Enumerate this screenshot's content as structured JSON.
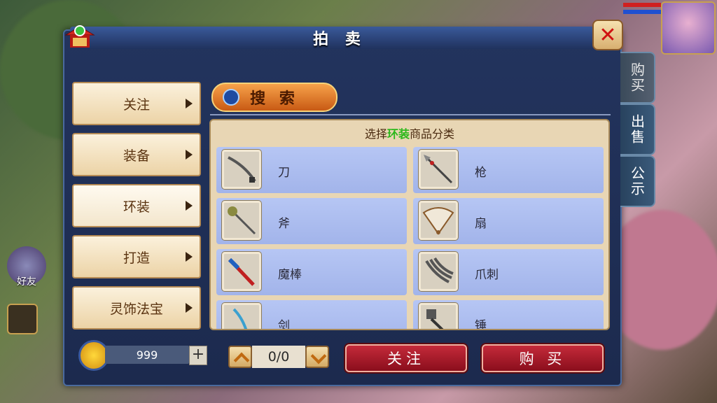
{
  "window": {
    "title": "拍 卖"
  },
  "side_tabs": [
    {
      "label": "购买"
    },
    {
      "label": "出售"
    },
    {
      "label": "公示"
    }
  ],
  "categories": [
    {
      "label": "关注"
    },
    {
      "label": "装备"
    },
    {
      "label": "环装"
    },
    {
      "label": "打造"
    },
    {
      "label": "灵饰法宝"
    }
  ],
  "search": {
    "label": "搜 索"
  },
  "content": {
    "header_prefix": "选择",
    "header_highlight": "环装",
    "header_suffix": "商品分类"
  },
  "items": [
    {
      "label": "刀",
      "icon": "saber-icon"
    },
    {
      "label": "枪",
      "icon": "spear-icon"
    },
    {
      "label": "斧",
      "icon": "axe-icon"
    },
    {
      "label": "扇",
      "icon": "fan-icon"
    },
    {
      "label": "魔棒",
      "icon": "wand-icon"
    },
    {
      "label": "爪刺",
      "icon": "claw-icon"
    },
    {
      "label": "剑",
      "icon": "sword-icon"
    },
    {
      "label": "锤",
      "icon": "hammer-icon"
    }
  ],
  "footer": {
    "coins": "999",
    "page": "0/0",
    "follow_label": "关注",
    "buy_label": "购 买"
  },
  "hud": {
    "friend_label": "好友"
  }
}
